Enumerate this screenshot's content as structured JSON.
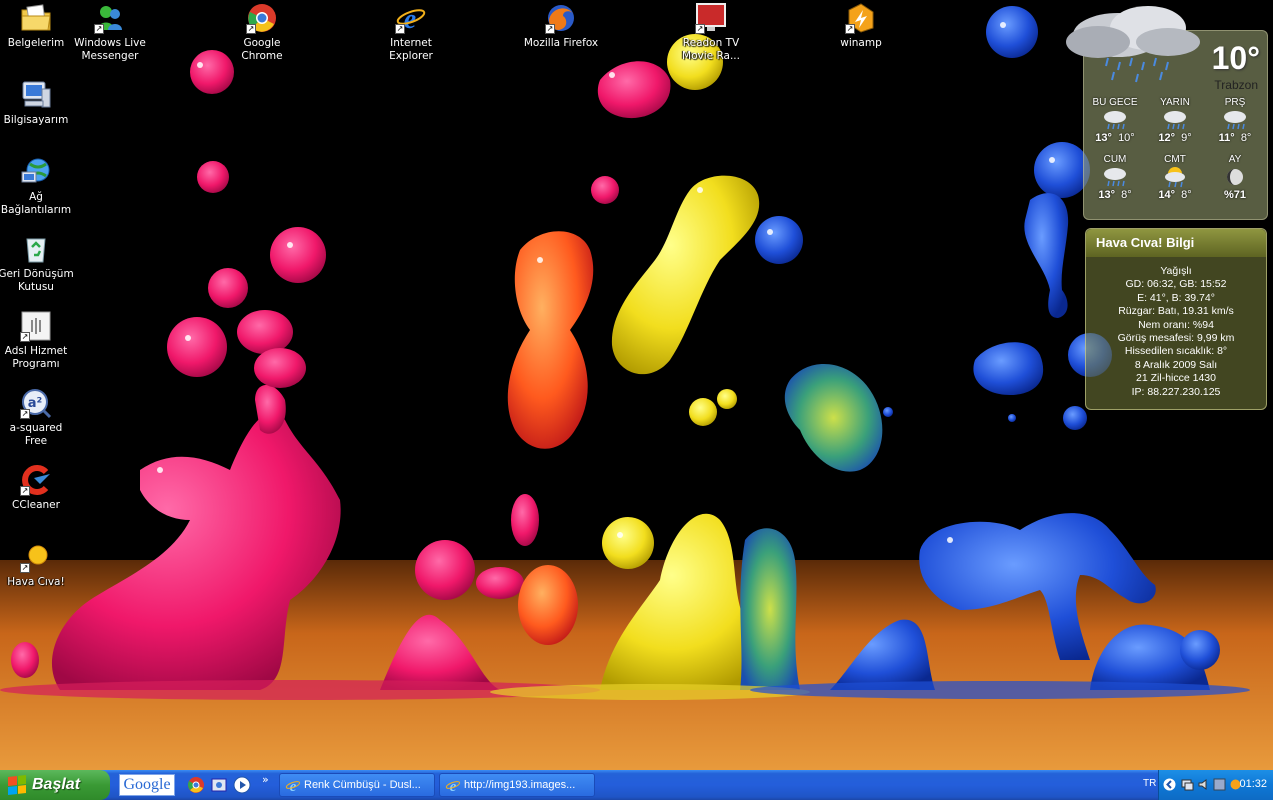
{
  "desktop": {
    "icons": [
      {
        "label": "Belgelerim",
        "icon": "documents-folder-icon"
      },
      {
        "label": "Bilgisayarım",
        "icon": "my-computer-icon"
      },
      {
        "label": "Ağ Bağlantılarım",
        "icon": "network-icon"
      },
      {
        "label": "Geri Dönüşüm Kutusu",
        "icon": "recycle-bin-icon"
      },
      {
        "label": "Adsl Hizmet Programı",
        "icon": "adsl-icon"
      },
      {
        "label": "a-squared Free",
        "icon": "a-squared-icon"
      },
      {
        "label": "CCleaner",
        "icon": "ccleaner-icon"
      },
      {
        "label": "Hava Cıva!",
        "icon": "weather-sun-icon"
      },
      {
        "label": "Windows Live Messenger",
        "icon": "messenger-icon"
      },
      {
        "label": "Google Chrome",
        "icon": "chrome-icon"
      },
      {
        "label": "Internet Explorer",
        "icon": "internet-explorer-icon"
      },
      {
        "label": "Mozilla Firefox",
        "icon": "firefox-icon"
      },
      {
        "label": "Readon TV Movie Ra...",
        "icon": "tv-icon"
      },
      {
        "label": "winamp",
        "icon": "winamp-icon"
      }
    ]
  },
  "weather": {
    "temp": "10°",
    "city": "Trabzon",
    "forecast_top": [
      {
        "day": "BU GECE",
        "hi": "13°",
        "lo": "10°",
        "icon": "rain-cloud-icon"
      },
      {
        "day": "YARIN",
        "hi": "12°",
        "lo": "9°",
        "icon": "rain-cloud-icon"
      },
      {
        "day": "PRŞ",
        "hi": "11°",
        "lo": "8°",
        "icon": "rain-cloud-icon"
      }
    ],
    "forecast_bottom": [
      {
        "day": "CUM",
        "hi": "13°",
        "lo": "8°",
        "icon": "rain-cloud-icon"
      },
      {
        "day": "CMT",
        "hi": "14°",
        "lo": "8°",
        "icon": "sun-rain-icon"
      },
      {
        "day": "AY",
        "value": "%71",
        "icon": "moon-icon"
      }
    ]
  },
  "info": {
    "title": "Hava Cıva! Bilgi",
    "lines": [
      "Yağışlı",
      "GD: 06:32, GB: 15:52",
      "E: 41°, B: 39.74°",
      "Rüzgar: Batı, 19.31 km/s",
      "Nem oranı: %94",
      "Görüş mesafesi: 9,99 km",
      "Hissedilen sıcaklık: 8°",
      "8 Aralık 2009 Salı",
      "21 Zil-hicce 1430",
      "IP: 88.227.230.125"
    ]
  },
  "taskbar": {
    "start_label": "Başlat",
    "google_label": "Google",
    "tasks": [
      {
        "label": "Renk Cümbüşü - Dusl...",
        "icon": "internet-explorer-icon"
      },
      {
        "label": "http://img193.images...",
        "icon": "internet-explorer-icon"
      }
    ],
    "lang": "TR",
    "clock": "01:32"
  }
}
